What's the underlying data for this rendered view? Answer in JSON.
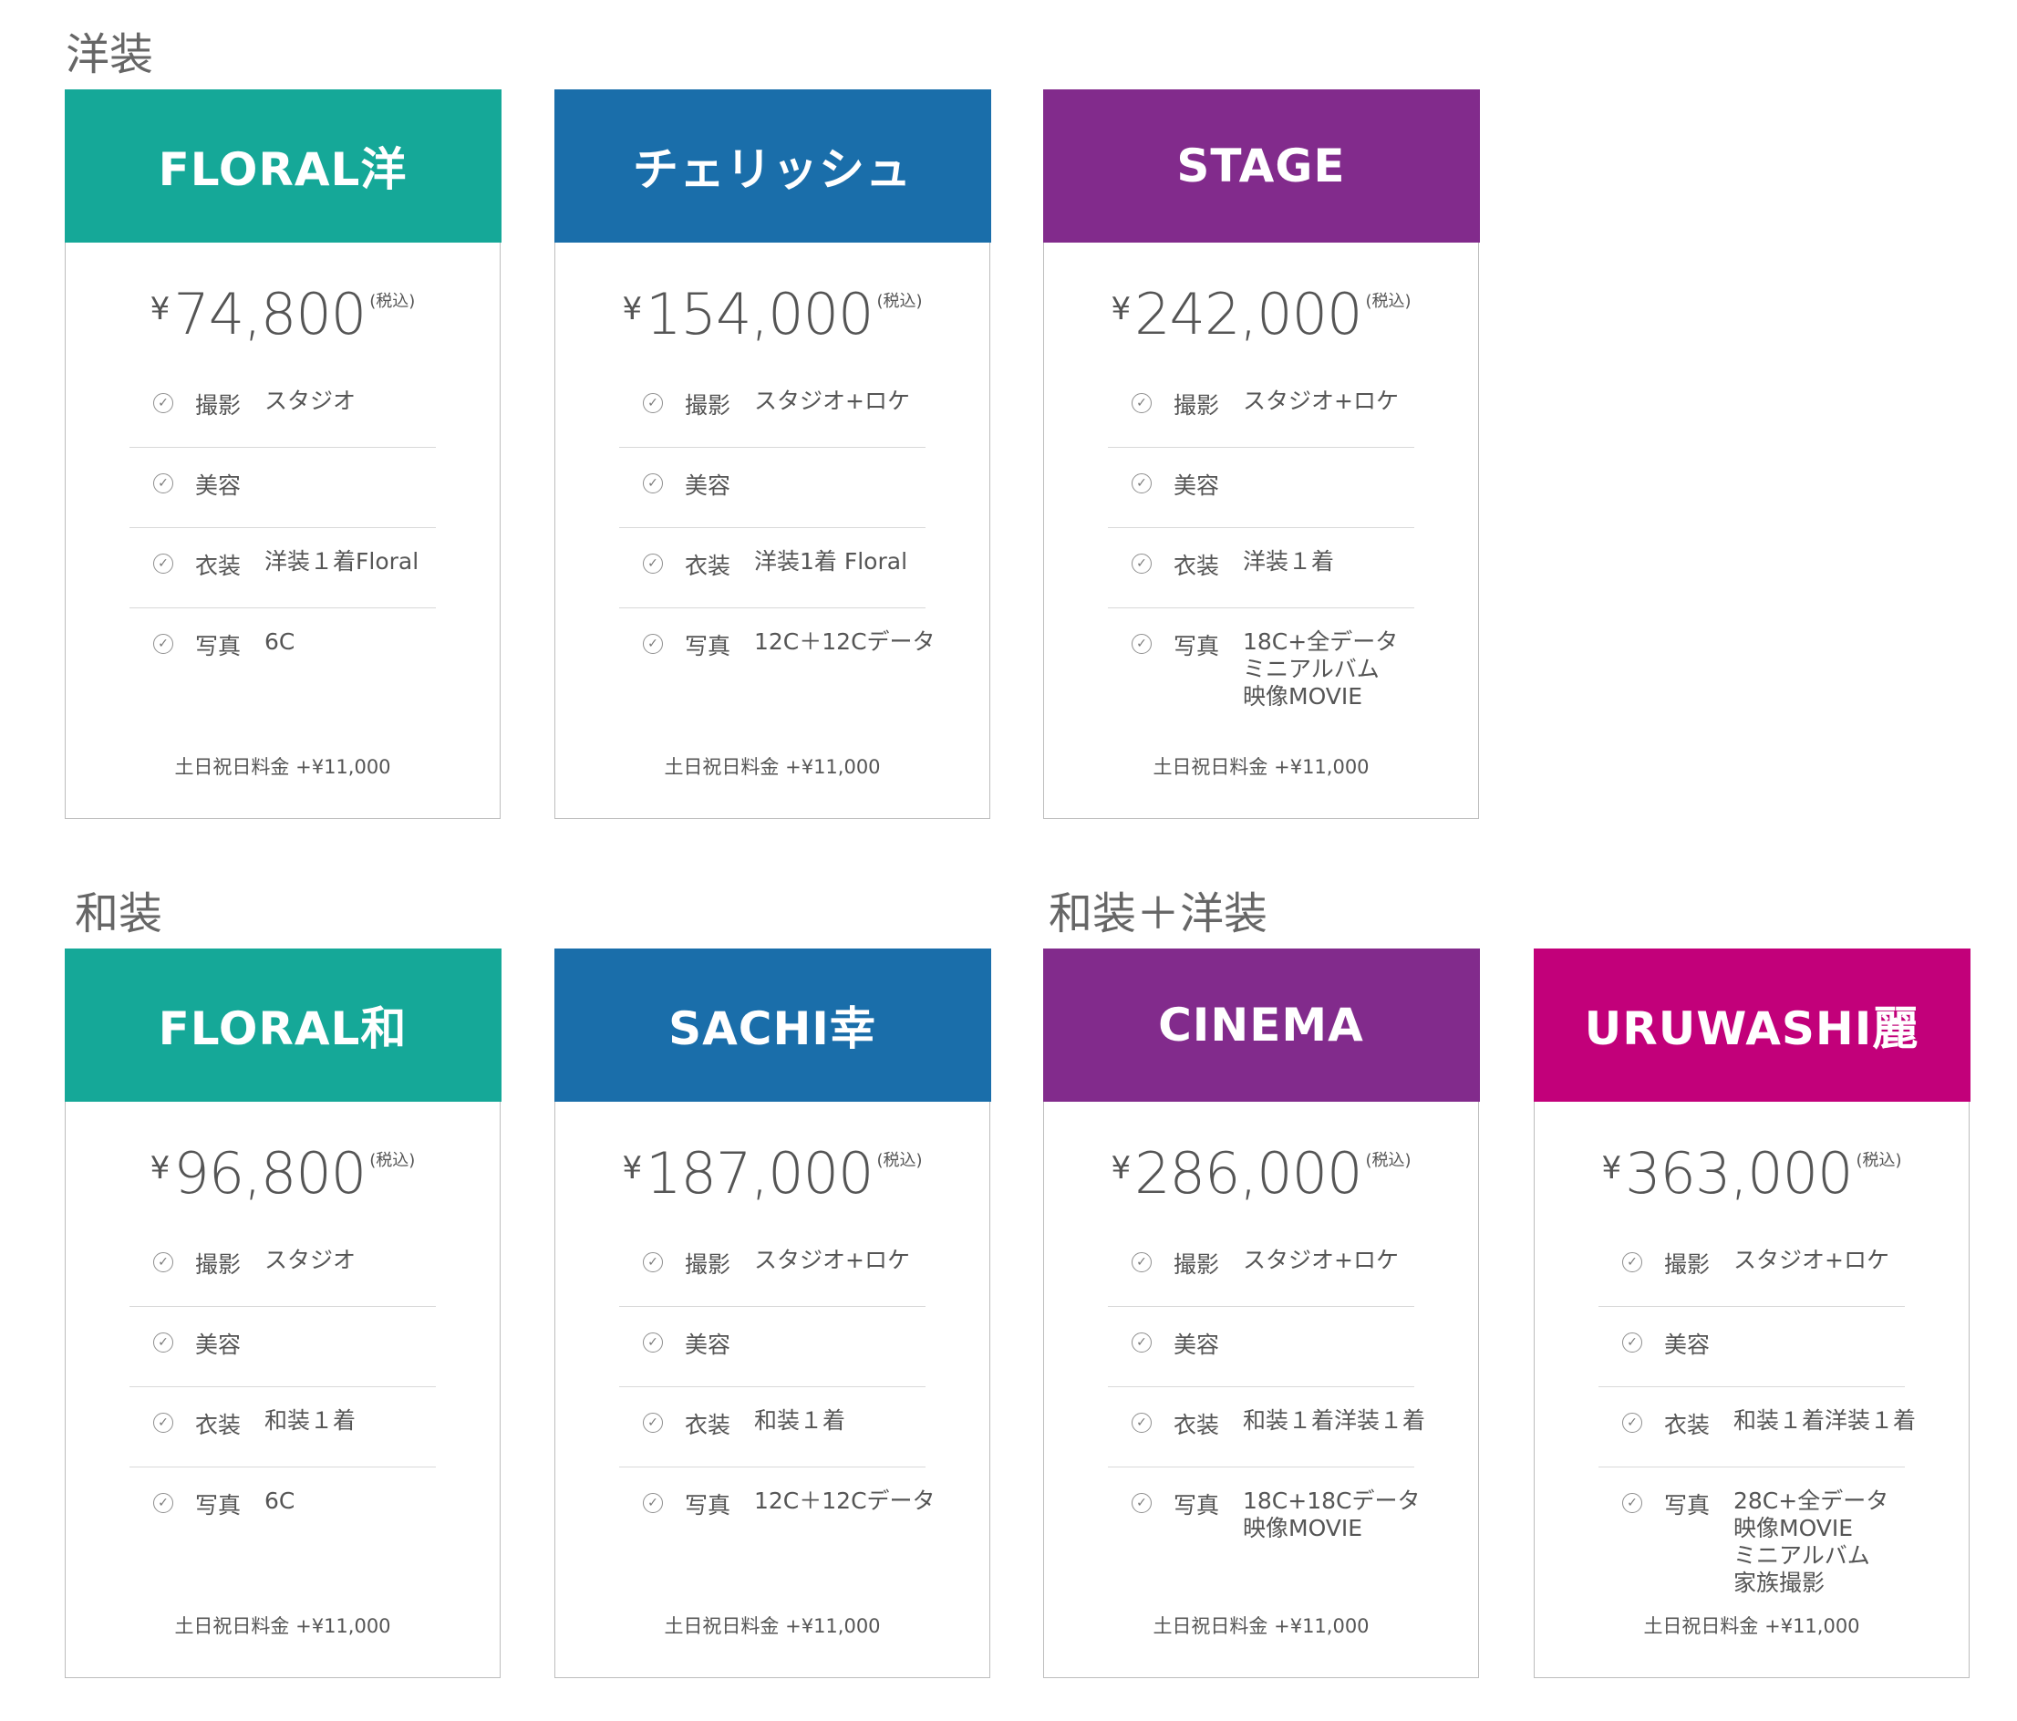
{
  "sections": {
    "western": "洋装",
    "japanese": "和装",
    "mixed": "和装＋洋装"
  },
  "colors": {
    "teal": "#15a898",
    "blue": "#1a6eaa",
    "purple": "#822b8c",
    "magenta": "#c2007a"
  },
  "cards": [
    {
      "name": "FLORAL洋",
      "color": "#15a898",
      "yen": "¥",
      "price": "74,800",
      "tax": "(税込)",
      "features": [
        {
          "label": "撮影",
          "lines": [
            "スタジオ"
          ]
        },
        {
          "label": "美容",
          "lines": []
        },
        {
          "label": "衣装",
          "lines": [
            "洋装１着Floral"
          ]
        },
        {
          "label": "写真",
          "lines": [
            "6C"
          ]
        }
      ],
      "footer": "土日祝日料金 +¥11,000"
    },
    {
      "name": "チェリッシュ",
      "color": "#1a6eaa",
      "yen": "¥",
      "price": "154,000",
      "tax": "(税込)",
      "features": [
        {
          "label": "撮影",
          "lines": [
            "スタジオ+ロケ"
          ]
        },
        {
          "label": "美容",
          "lines": []
        },
        {
          "label": "衣装",
          "lines": [
            "洋装1着 Floral"
          ]
        },
        {
          "label": "写真",
          "lines": [
            "12C＋12Cデータ"
          ]
        }
      ],
      "footer": "土日祝日料金 +¥11,000"
    },
    {
      "name": "STAGE",
      "color": "#822b8c",
      "yen": "¥",
      "price": "242,000",
      "tax": "(税込)",
      "features": [
        {
          "label": "撮影",
          "lines": [
            "スタジオ+ロケ"
          ]
        },
        {
          "label": "美容",
          "lines": []
        },
        {
          "label": "衣装",
          "lines": [
            "洋装１着"
          ]
        },
        {
          "label": "写真",
          "lines": [
            "18C+全データ",
            "ミニアルバム",
            "映像MOVIE"
          ]
        }
      ],
      "footer": "土日祝日料金 +¥11,000"
    },
    {
      "name": "FLORAL和",
      "color": "#15a898",
      "yen": "¥",
      "price": "96,800",
      "tax": "(税込)",
      "features": [
        {
          "label": "撮影",
          "lines": [
            "スタジオ"
          ]
        },
        {
          "label": "美容",
          "lines": []
        },
        {
          "label": "衣装",
          "lines": [
            "和装１着"
          ]
        },
        {
          "label": "写真",
          "lines": [
            "6C"
          ]
        }
      ],
      "footer": "土日祝日料金 +¥11,000"
    },
    {
      "name": "SACHI幸",
      "color": "#1a6eaa",
      "yen": "¥",
      "price": "187,000",
      "tax": "(税込)",
      "features": [
        {
          "label": "撮影",
          "lines": [
            "スタジオ+ロケ"
          ]
        },
        {
          "label": "美容",
          "lines": []
        },
        {
          "label": "衣装",
          "lines": [
            "和装１着"
          ]
        },
        {
          "label": "写真",
          "lines": [
            "12C＋12Cデータ"
          ]
        }
      ],
      "footer": "土日祝日料金 +¥11,000"
    },
    {
      "name": "CINEMA",
      "color": "#822b8c",
      "yen": "¥",
      "price": "286,000",
      "tax": "(税込)",
      "features": [
        {
          "label": "撮影",
          "lines": [
            "スタジオ+ロケ"
          ]
        },
        {
          "label": "美容",
          "lines": []
        },
        {
          "label": "衣装",
          "lines": [
            "和装１着洋装１着"
          ]
        },
        {
          "label": "写真",
          "lines": [
            "18C+18Cデータ",
            "映像MOVIE"
          ]
        }
      ],
      "footer": "土日祝日料金 +¥11,000"
    },
    {
      "name": "URUWASHI麗",
      "color": "#c2007a",
      "yen": "¥",
      "price": "363,000",
      "tax": "(税込)",
      "features": [
        {
          "label": "撮影",
          "lines": [
            "スタジオ+ロケ"
          ]
        },
        {
          "label": "美容",
          "lines": []
        },
        {
          "label": "衣装",
          "lines": [
            "和装１着洋装１着"
          ]
        },
        {
          "label": "写真",
          "lines": [
            "28C+全データ",
            "映像MOVIE",
            "ミニアルバム",
            "家族撮影"
          ]
        }
      ],
      "footer": "土日祝日料金 +¥11,000"
    }
  ]
}
